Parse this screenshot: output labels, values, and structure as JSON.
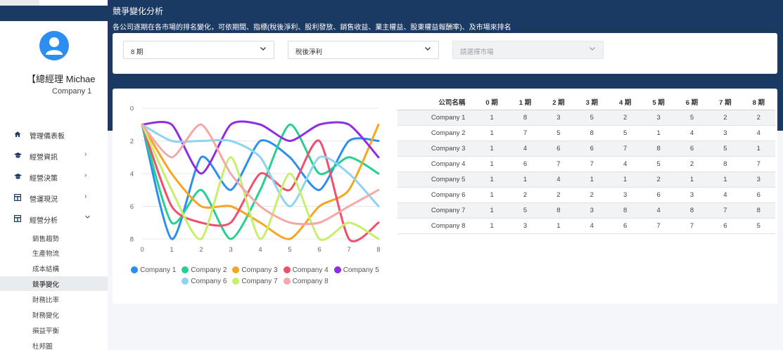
{
  "sidebar": {
    "user_name": "【總經理 Michae",
    "user_company": "Company 1",
    "nav": [
      {
        "label": "管理儀表板",
        "icon": "home-icon",
        "arrow": ""
      },
      {
        "label": "經營資訊",
        "icon": "graduation-cap-icon",
        "arrow": "›"
      },
      {
        "label": "經營決策",
        "icon": "graduation-cap-icon",
        "arrow": "›"
      },
      {
        "label": "營運現況",
        "icon": "table-icon",
        "arrow": "›"
      },
      {
        "label": "經營分析",
        "icon": "table-icon",
        "arrow": "⌄"
      }
    ],
    "sub": [
      "銷售趨勢",
      "生產物流",
      "成本結構",
      "競爭變化",
      "財務比率",
      "財務變化",
      "損益平衡",
      "杜邦圖"
    ]
  },
  "page": {
    "title": "競爭變化分析",
    "description": "各公司逐期在各市場的排名變化，可依期間、指標(稅後淨利、股利發放、銷售收益、業主權益、股東權益報酬率)、及市場來排名"
  },
  "filters": {
    "period": "8 期",
    "metric": "稅後淨利",
    "market_placeholder": "請選擇市場"
  },
  "chart_data": {
    "type": "line",
    "x": [
      0,
      1,
      2,
      3,
      4,
      5,
      6,
      7,
      8
    ],
    "ylim": [
      8,
      0
    ],
    "y_ticks": [
      0,
      2,
      4,
      6,
      8
    ],
    "x_ticks": [
      0,
      1,
      2,
      3,
      4,
      5,
      6,
      7,
      8
    ],
    "legend_position": "bottom",
    "series": [
      {
        "name": "Company 1",
        "color": "#2b8ef0",
        "values": [
          1,
          8,
          3,
          5,
          2,
          3,
          5,
          2,
          2
        ]
      },
      {
        "name": "Company 2",
        "color": "#27d08f",
        "values": [
          1,
          7,
          5,
          8,
          5,
          1,
          4,
          3,
          4
        ]
      },
      {
        "name": "Company 3",
        "color": "#f5a623",
        "values": [
          1,
          4,
          6,
          6,
          7,
          8,
          6,
          5,
          1
        ]
      },
      {
        "name": "Company 4",
        "color": "#f0506e",
        "values": [
          1,
          6,
          7,
          7,
          4,
          5,
          2,
          8,
          7
        ]
      },
      {
        "name": "Company 5",
        "color": "#8e2de2",
        "values": [
          1,
          1,
          4,
          1,
          1,
          2,
          1,
          1,
          3
        ]
      },
      {
        "name": "Company 6",
        "color": "#8fd3f2",
        "values": [
          1,
          2,
          2,
          2,
          3,
          6,
          3,
          4,
          6
        ]
      },
      {
        "name": "Company 7",
        "color": "#c8ee6a",
        "values": [
          1,
          5,
          8,
          3,
          8,
          4,
          8,
          7,
          8
        ]
      },
      {
        "name": "Company 8",
        "color": "#f5a8a8",
        "values": [
          1,
          3,
          1,
          4,
          6,
          7,
          7,
          6,
          5
        ]
      }
    ]
  },
  "table": {
    "header_company": "公司名稱",
    "period_headers": [
      "0 期",
      "1 期",
      "2 期",
      "3 期",
      "4 期",
      "5 期",
      "6 期",
      "7 期",
      "8 期"
    ],
    "rows": [
      {
        "company": "Company 1",
        "ranks": [
          1,
          8,
          3,
          5,
          2,
          3,
          5,
          2,
          2
        ]
      },
      {
        "company": "Company 2",
        "ranks": [
          1,
          7,
          5,
          8,
          5,
          1,
          4,
          3,
          4
        ]
      },
      {
        "company": "Company 3",
        "ranks": [
          1,
          4,
          6,
          6,
          7,
          8,
          6,
          5,
          1
        ]
      },
      {
        "company": "Company 4",
        "ranks": [
          1,
          6,
          7,
          7,
          4,
          5,
          2,
          8,
          7
        ]
      },
      {
        "company": "Company 5",
        "ranks": [
          1,
          1,
          4,
          1,
          1,
          2,
          1,
          1,
          3
        ]
      },
      {
        "company": "Company 6",
        "ranks": [
          1,
          2,
          2,
          2,
          3,
          6,
          3,
          4,
          6
        ]
      },
      {
        "company": "Company 7",
        "ranks": [
          1,
          5,
          8,
          3,
          8,
          4,
          8,
          7,
          8
        ]
      },
      {
        "company": "Company 8",
        "ranks": [
          1,
          3,
          1,
          4,
          6,
          7,
          7,
          6,
          5
        ]
      }
    ]
  }
}
